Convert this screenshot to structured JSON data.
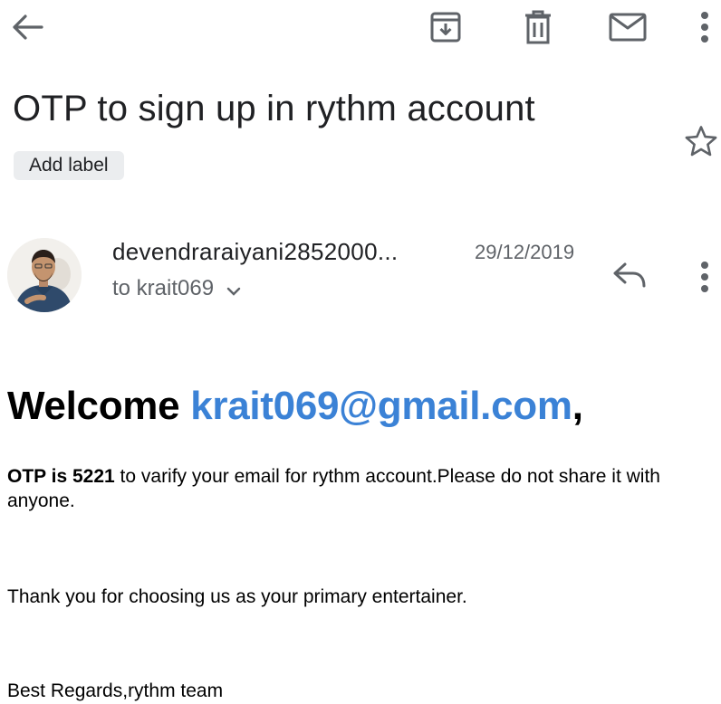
{
  "toolbar": {
    "back_icon": "arrow-left-icon",
    "archive_icon": "archive-icon",
    "delete_icon": "trash-icon",
    "mark_unread_icon": "envelope-icon",
    "more_icon": "more-vert-icon"
  },
  "email": {
    "subject": "OTP to sign up in rythm account",
    "add_label": "Add label",
    "star_icon": "star-outline-icon",
    "sender": "devendraraiyani2852000...",
    "date": "29/12/2019",
    "recipient": "to krait069",
    "reply_icon": "reply-icon",
    "sender_more_icon": "more-vert-icon"
  },
  "body": {
    "welcome_prefix": "Welcome ",
    "welcome_email": "krait069@gmail.com",
    "welcome_suffix": ",",
    "otp_bold": "OTP is 5221",
    "otp_rest": " to varify your email for rythm account.Please do not share it with anyone.",
    "thanks": "Thank you for choosing us as your primary entertainer.",
    "regards": "Best Regards,rythm team"
  },
  "colors": {
    "link": "#3b82d6",
    "icon_gray": "#5f6368",
    "label_bg": "#ebedef"
  }
}
